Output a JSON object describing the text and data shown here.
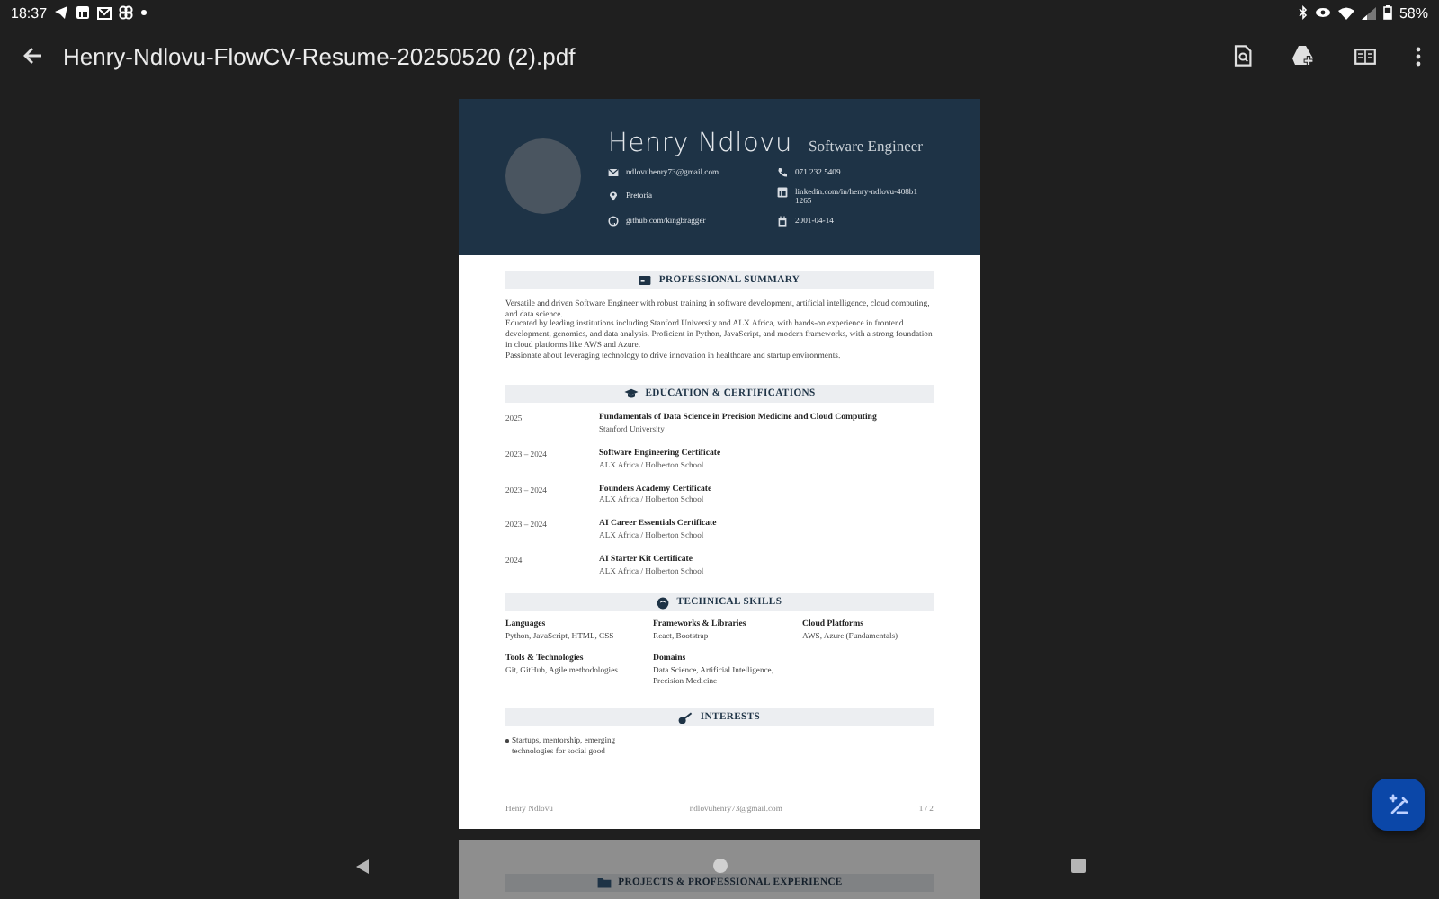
{
  "status_bar": {
    "time": "18:37",
    "battery": "58%"
  },
  "app_bar": {
    "title": "Henry-Ndlovu-FlowCV-Resume-20250520 (2).pdf"
  },
  "resume": {
    "name": "Henry Ndlovu",
    "role": "Software Engineer",
    "contacts": [
      {
        "kind": "email",
        "text": "ndlovuhenry73@gmail.com"
      },
      {
        "kind": "phone",
        "text": "071 232 5409"
      },
      {
        "kind": "location",
        "text": "Pretoria"
      },
      {
        "kind": "linkedin",
        "text": "linkedin.com/in/henry-ndlovu-408b11265"
      },
      {
        "kind": "github",
        "text": "github.com/kingbragger"
      },
      {
        "kind": "birthday",
        "text": "2001-04-14"
      }
    ],
    "sections": [
      {
        "kind": "summary",
        "title": "PROFESSIONAL SUMMARY",
        "paragraphs": [
          "Versatile and driven Software Engineer with robust training in software development, artificial intelligence, cloud computing, and data science.",
          "Educated by leading institutions including Stanford University and ALX Africa, with hands-on experience in frontend development, genomics, and data analysis. Proficient in Python, JavaScript, and modern frameworks, with a strong foundation in cloud platforms like AWS and Azure.",
          "Passionate about leveraging technology to drive innovation in healthcare and startup environments."
        ]
      },
      {
        "kind": "education",
        "title": "EDUCATION & CERTIFICATIONS",
        "entries": [
          {
            "date": "2025",
            "title": "Fundamentals of Data Science in Precision Medicine and Cloud Computing",
            "org": "Stanford University"
          },
          {
            "date": "2023 – 2024",
            "title": "Software Engineering Certificate",
            "org": "ALX Africa / Holberton School"
          },
          {
            "date": "2023 – 2024",
            "title": "Founders Academy Certificate",
            "org": "ALX Africa / Holberton School"
          },
          {
            "date": "2023 – 2024",
            "title": "AI Career Essentials Certificate",
            "org": "ALX Africa / Holberton School"
          },
          {
            "date": "2024",
            "title": "AI Starter Kit Certificate",
            "org": "ALX Africa / Holberton School"
          }
        ]
      },
      {
        "kind": "skills",
        "title": "TECHNICAL SKILLS",
        "groups": [
          {
            "label": "Languages",
            "text": "Python, JavaScript, HTML, CSS"
          },
          {
            "label": "Frameworks & Libraries",
            "text": "React, Bootstrap"
          },
          {
            "label": "Cloud Platforms",
            "text": "AWS, Azure (Fundamentals)"
          },
          {
            "label": "Tools & Technologies",
            "text": "Git, GitHub, Agile methodologies"
          },
          {
            "label": "Domains",
            "text": "Data Science, Artificial Intelligence, Precision Medicine"
          }
        ]
      },
      {
        "kind": "interests",
        "title": "INTERESTS",
        "items": [
          "Startups, mentorship, emerging technologies for social good"
        ]
      }
    ],
    "footer": {
      "name": "Henry Ndlovu",
      "email": "ndlovuhenry73@gmail.com",
      "page": "1 / 2"
    }
  },
  "next_page": {
    "section_title": "PROJECTS & PROFESSIONAL EXPERIENCE"
  }
}
